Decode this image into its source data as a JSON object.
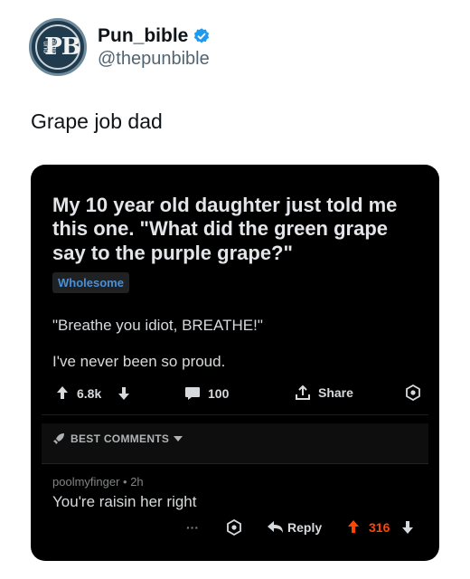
{
  "tweet": {
    "display_name": "Pun_bible",
    "handle": "@thepunbible",
    "text": "Grape job dad",
    "avatar": {
      "monogram": "PB",
      "side_text": "pun bible"
    },
    "verified_color": "#1d9bf0"
  },
  "reddit_card": {
    "title": "My 10 year old daughter just told me this one. \"What did the green grape say to the purple grape?\"",
    "flair": "Wholesome",
    "body_lines": [
      "\"Breathe you idiot, BREATHE!\"",
      "I've never been so proud."
    ],
    "actions": {
      "score": "6.8k",
      "comments": "100",
      "share": "Share"
    },
    "sort_label": "BEST COMMENTS",
    "comment": {
      "meta": "poolmyfinger • 2h",
      "text": "You're raisin her right",
      "more": "···",
      "reply": "Reply",
      "score": "316",
      "upvote_color": "#ff4500"
    }
  }
}
